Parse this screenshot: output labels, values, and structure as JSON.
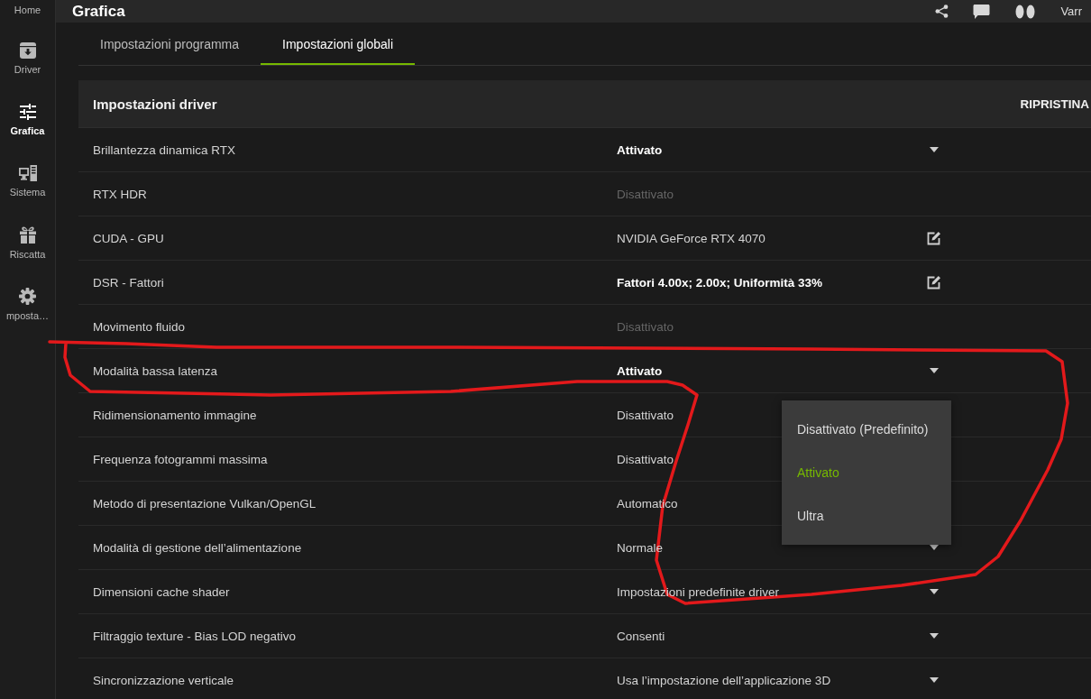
{
  "app_bar": {
    "title": "Grafica",
    "user": "Varr"
  },
  "sidebar": {
    "items": [
      {
        "label": "Home",
        "selected": false
      },
      {
        "label": "Driver",
        "selected": false
      },
      {
        "label": "Grafica",
        "selected": true
      },
      {
        "label": "Sistema",
        "selected": false
      },
      {
        "label": "Riscatta",
        "selected": false
      },
      {
        "label": "mposta…",
        "selected": false
      }
    ]
  },
  "tabs": [
    {
      "label": "Impostazioni programma",
      "selected": false
    },
    {
      "label": "Impostazioni globali",
      "selected": true
    }
  ],
  "panel": {
    "title": "Impostazioni driver",
    "action": "RIPRISTINA",
    "rows": [
      {
        "label": "Brillantezza dinamica RTX",
        "value": "Attivato",
        "modified": true,
        "disabled": false,
        "kind": "dropdown",
        "circled": false
      },
      {
        "label": "RTX HDR",
        "value": "Disattivato",
        "modified": false,
        "disabled": true,
        "kind": "plain",
        "circled": false
      },
      {
        "label": "CUDA - GPU",
        "value": "NVIDIA GeForce RTX 4070",
        "modified": false,
        "disabled": false,
        "kind": "edit",
        "circled": false
      },
      {
        "label": "DSR - Fattori",
        "value": "Fattori 4.00x; 2.00x; Uniformità 33%",
        "modified": true,
        "disabled": false,
        "kind": "edit",
        "circled": false
      },
      {
        "label": "Movimento fluido",
        "value": "Disattivato",
        "modified": false,
        "disabled": true,
        "kind": "plain",
        "circled": false
      },
      {
        "label": "Modalità bassa latenza",
        "value": "Attivato",
        "modified": true,
        "disabled": false,
        "kind": "dropdown",
        "circled": true,
        "menu": {
          "options": [
            {
              "label": "Disattivato (Predefinito)",
              "selected": false
            },
            {
              "label": "Attivato",
              "selected": true
            },
            {
              "label": "Ultra",
              "selected": false
            }
          ]
        }
      },
      {
        "label": "Ridimensionamento immagine",
        "value": "Disattivato",
        "modified": false,
        "disabled": false,
        "kind": "plain",
        "circled": false
      },
      {
        "label": "Frequenza fotogrammi massima",
        "value": "Disattivato",
        "modified": false,
        "disabled": false,
        "kind": "plain",
        "circled": false
      },
      {
        "label": "Metodo di presentazione Vulkan/OpenGL",
        "value": "Automatico",
        "modified": false,
        "disabled": false,
        "kind": "plain",
        "circled": false
      },
      {
        "label": "Modalità di gestione dell’alimentazione",
        "value": "Normale",
        "modified": false,
        "disabled": false,
        "kind": "dropdown",
        "circled": false
      },
      {
        "label": "Dimensioni cache shader",
        "value": "Impostazioni predefinite driver",
        "modified": false,
        "disabled": false,
        "kind": "dropdown",
        "circled": false
      },
      {
        "label": "Filtraggio texture - Bias LOD negativo",
        "value": "Consenti",
        "modified": false,
        "disabled": false,
        "kind": "dropdown",
        "circled": false
      },
      {
        "label": "Sincronizzazione verticale",
        "value": "Usa l’impostazione dell’applicazione 3D",
        "modified": false,
        "disabled": false,
        "kind": "dropdown",
        "circled": false
      }
    ]
  }
}
